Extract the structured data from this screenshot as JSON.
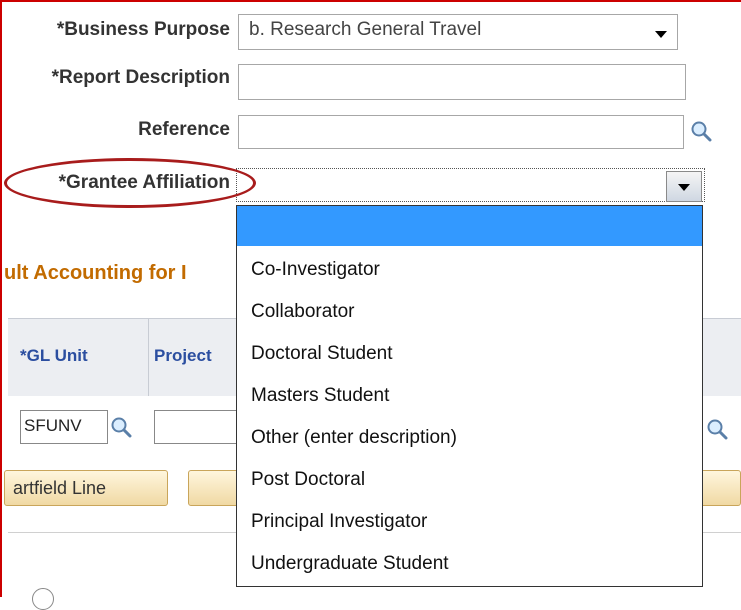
{
  "form": {
    "business_purpose": {
      "label": "*Business Purpose",
      "value": "b. Research General Travel"
    },
    "report_description": {
      "label": "*Report Description",
      "value": ""
    },
    "reference": {
      "label": "Reference",
      "value": ""
    },
    "grantee_affiliation": {
      "label": "*Grantee Affiliation",
      "value": ""
    }
  },
  "dropdown": {
    "options": [
      "",
      "Co-Investigator",
      "Collaborator",
      "Doctoral Student",
      "Masters Student",
      "Other (enter description)",
      "Post Doctoral",
      "Principal Investigator",
      "Undergraduate Student"
    ],
    "selected_index": 0
  },
  "accounting": {
    "section_title": "ult Accounting for I",
    "columns": {
      "gl_unit": "*GL Unit",
      "project": "Project"
    },
    "row": {
      "gl_unit_value": "SFUNV",
      "project_value": ""
    },
    "chartfield_button_label": "artfield Line"
  },
  "colors": {
    "accent": "#a81c1c",
    "selected_option": "#3399ff",
    "section_title": "#c26b00",
    "column_header": "#2b4ea0"
  },
  "icons": [
    "lookup-icon",
    "dropdown-arrow-icon",
    "radio-icon"
  ]
}
